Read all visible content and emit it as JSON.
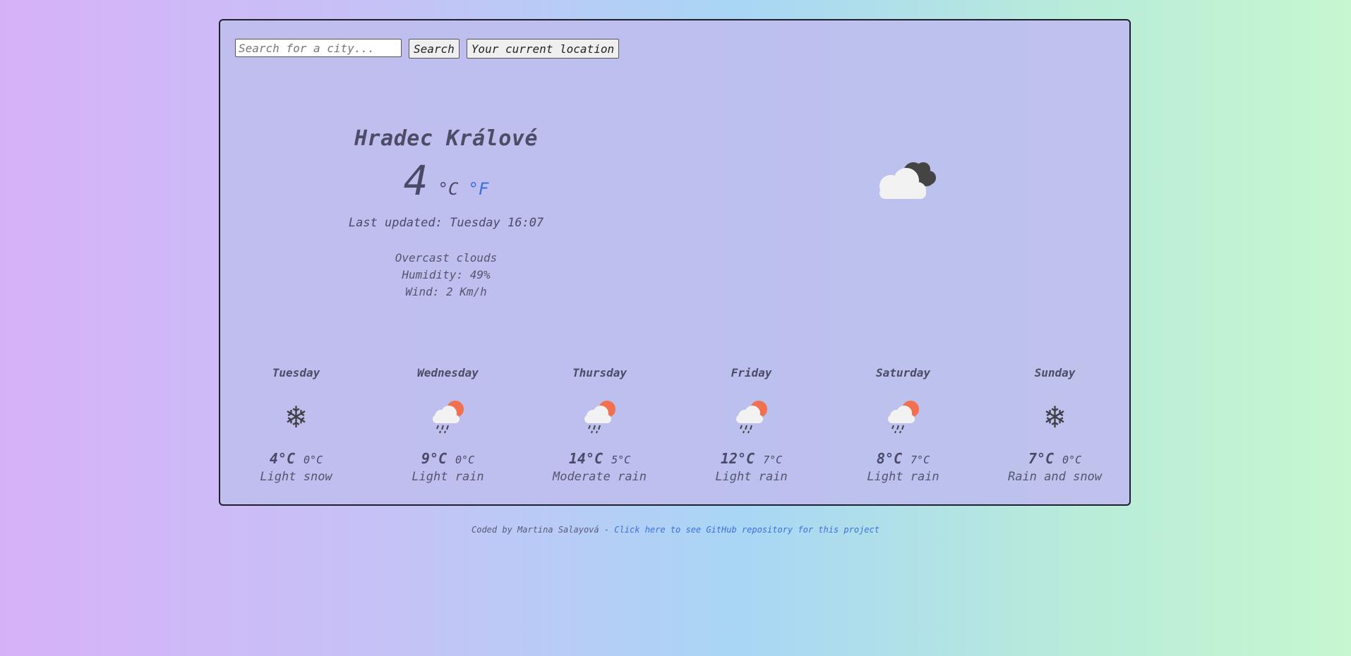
{
  "search": {
    "placeholder": "Search for a city...",
    "search_label": "Search",
    "location_label": "Your current location"
  },
  "current": {
    "city": "Hradec Králové",
    "temp": "4",
    "unit_c": "°C",
    "unit_f": "°F",
    "updated": "Last updated: Tuesday 16:07",
    "description": "Overcast clouds",
    "humidity": "Humidity: 49%",
    "wind": "Wind: 2 Km/h",
    "icon": "overcast-clouds-icon"
  },
  "forecast": [
    {
      "day": "Tuesday",
      "max": "4°C",
      "min": "0°C",
      "desc": "Light snow",
      "icon": "snowflake-icon"
    },
    {
      "day": "Wednesday",
      "max": "9°C",
      "min": "0°C",
      "desc": "Light rain",
      "icon": "sun-rain-cloud-icon"
    },
    {
      "day": "Thursday",
      "max": "14°C",
      "min": "5°C",
      "desc": "Moderate rain",
      "icon": "sun-rain-cloud-icon"
    },
    {
      "day": "Friday",
      "max": "12°C",
      "min": "7°C",
      "desc": "Light rain",
      "icon": "sun-rain-cloud-icon"
    },
    {
      "day": "Saturday",
      "max": "8°C",
      "min": "7°C",
      "desc": "Light rain",
      "icon": "sun-rain-cloud-icon"
    },
    {
      "day": "Sunday",
      "max": "7°C",
      "min": "0°C",
      "desc": "Rain and snow",
      "icon": "snowflake-icon"
    }
  ],
  "footer": {
    "credit": "Coded by Martina Salayová - ",
    "link": "Click here to see GitHub repository for this project"
  },
  "colors": {
    "link": "#3b6fe0",
    "sun": "#f07050",
    "cloud": "#f2f2f2",
    "dark_cloud": "#444444"
  }
}
